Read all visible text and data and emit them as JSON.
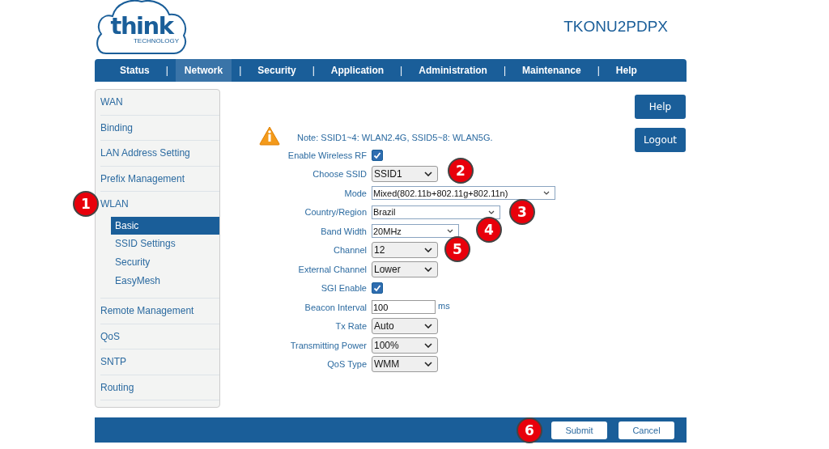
{
  "header": {
    "logo_text": "think",
    "logo_subtext": "TECHNOLOGY",
    "device_name": "TKONU2PDPX"
  },
  "nav": [
    {
      "label": "Status",
      "selected": false
    },
    {
      "label": "Network",
      "selected": true
    },
    {
      "label": "Security",
      "selected": false
    },
    {
      "label": "Application",
      "selected": false
    },
    {
      "label": "Administration",
      "selected": false
    },
    {
      "label": "Maintenance",
      "selected": false
    },
    {
      "label": "Help",
      "selected": false
    }
  ],
  "nav_separator": "|",
  "sidebar": [
    {
      "label": "WAN"
    },
    {
      "label": "Binding"
    },
    {
      "label": "LAN Address Setting"
    },
    {
      "label": "Prefix Management"
    },
    {
      "label": "WLAN",
      "children": [
        {
          "label": "Basic",
          "selected": true
        },
        {
          "label": "SSID Settings",
          "selected": false
        },
        {
          "label": "Security",
          "selected": false
        },
        {
          "label": "EasyMesh",
          "selected": false
        }
      ]
    },
    {
      "label": "Remote Management"
    },
    {
      "label": "QoS"
    },
    {
      "label": "SNTP"
    },
    {
      "label": "Routing"
    }
  ],
  "note": "Note: SSID1~4: WLAN2.4G, SSID5~8: WLAN5G.",
  "form": [
    {
      "kind": "checkbox",
      "label": "Enable Wireless RF",
      "checked": true
    },
    {
      "kind": "select",
      "label": "Choose SSID",
      "value": "SSID1"
    },
    {
      "kind": "flat-select",
      "label": "Mode",
      "value": "Mixed(802.11b+802.11g+802.11n)"
    },
    {
      "kind": "flat-select",
      "label": "Country/Region",
      "value": "Brazil"
    },
    {
      "kind": "flat-select",
      "label": "Band Width",
      "value": "20MHz"
    },
    {
      "kind": "select",
      "label": "Channel",
      "value": "12"
    },
    {
      "kind": "select",
      "label": "External Channel",
      "value": "Lower"
    },
    {
      "kind": "checkbox",
      "label": "SGI Enable",
      "checked": true
    },
    {
      "kind": "text",
      "label": "Beacon Interval",
      "value": "100",
      "unit": "ms"
    },
    {
      "kind": "select",
      "label": "Tx Rate",
      "value": "Auto"
    },
    {
      "kind": "select",
      "label": "Transmitting Power",
      "value": "100%"
    },
    {
      "kind": "select",
      "label": "QoS Type",
      "value": "WMM"
    }
  ],
  "side_buttons": [
    "Help",
    "Logout"
  ],
  "footer_buttons": [
    "Submit",
    "Cancel"
  ],
  "markers": [
    "1",
    "2",
    "3",
    "4",
    "5",
    "6"
  ]
}
